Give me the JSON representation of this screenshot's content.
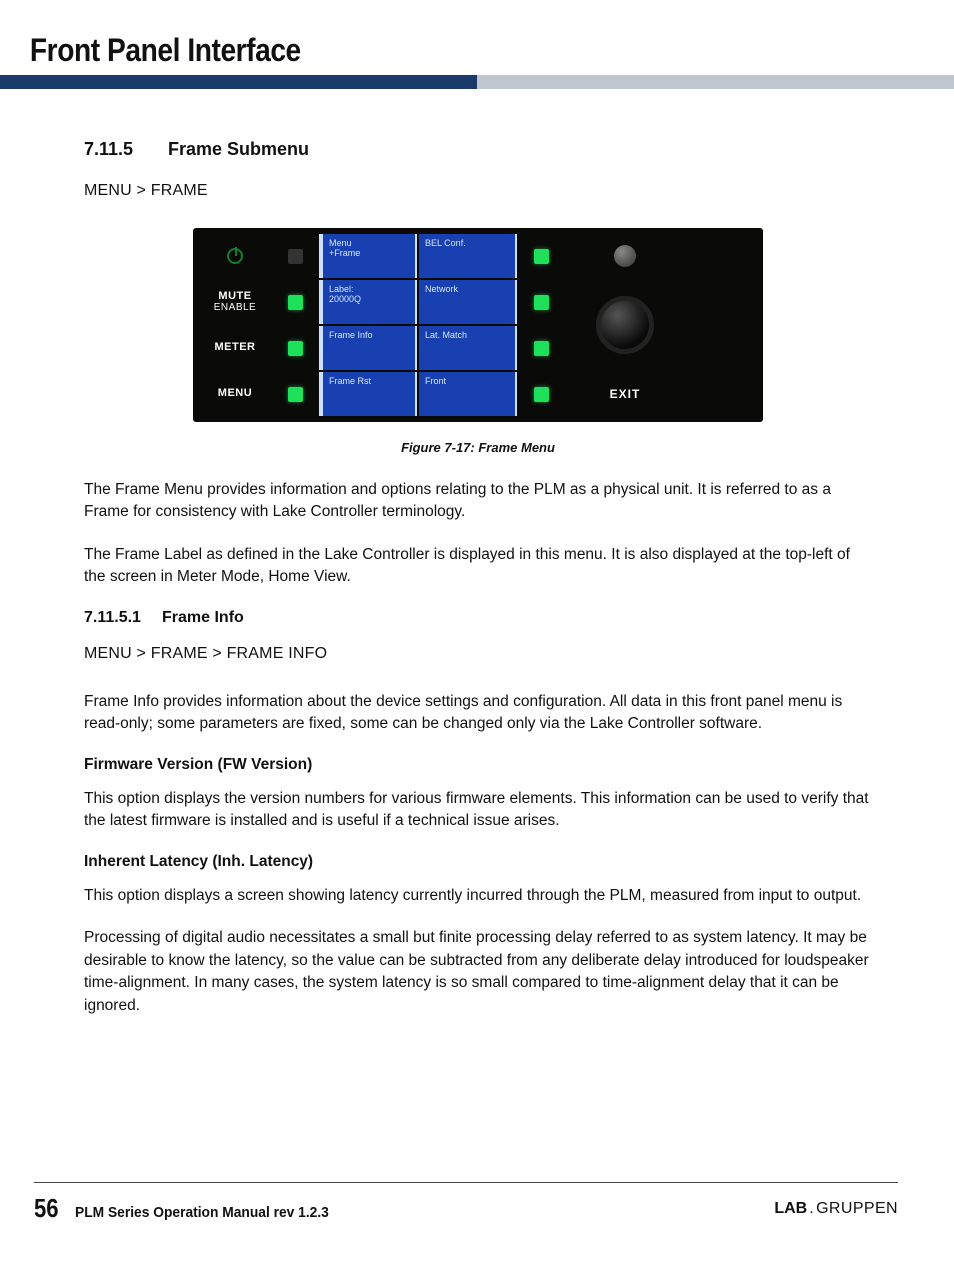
{
  "header": {
    "page_title": "Front Panel Interface"
  },
  "section_7_11_5": {
    "num": "7.11.5",
    "title": "Frame Submenu",
    "breadcrumb": "MENU > FRAME"
  },
  "panel": {
    "row_labels": [
      {
        "main": "",
        "sub": "",
        "icon": "power"
      },
      {
        "main": "MUTE",
        "sub": "ENABLE"
      },
      {
        "main": "METER",
        "sub": ""
      },
      {
        "main": "MENU",
        "sub": ""
      }
    ],
    "screen_col1": [
      {
        "l1": "Menu",
        "l2": "+Frame"
      },
      {
        "l1": "Label:",
        "l2": "20000Q"
      },
      {
        "l1": "Frame Info",
        "l2": ""
      },
      {
        "l1": "Frame Rst",
        "l2": ""
      }
    ],
    "screen_col2": [
      {
        "l1": "BEL Conf.",
        "l2": ""
      },
      {
        "l1": "Network",
        "l2": ""
      },
      {
        "l1": "Lat. Match",
        "l2": ""
      },
      {
        "l1": "Front",
        "l2": ""
      }
    ],
    "exit_label": "EXIT"
  },
  "figure_caption": "Figure 7-17: Frame Menu",
  "para1": "The Frame Menu provides information and options relating to the PLM as a physical unit. It is referred to as a Frame for consistency with Lake Controller terminology.",
  "para2": "The Frame Label as defined in the Lake Controller is displayed in this menu. It is also displayed at the top-left of the screen in Meter Mode, Home View.",
  "section_7_11_5_1": {
    "num": "7.11.5.1",
    "title": "Frame Info",
    "breadcrumb": "MENU > FRAME > FRAME INFO"
  },
  "para3": "Frame Info provides information about the device settings and configuration. All data in this front panel menu is read-only; some parameters are fixed, some can be changed only via the Lake Controller software.",
  "fw_heading": "Firmware Version (FW Version)",
  "para4": "This option displays the version numbers for various firmware elements. This information can be used to verify that the latest firmware is installed and is useful if a technical issue arises.",
  "inh_heading": "Inherent Latency (Inh. Latency)",
  "para5": "This option displays a screen showing latency currently incurred through the PLM, measured from input to output.",
  "para6": "Processing of digital audio necessitates a small but finite processing delay referred to as system latency. It may be desirable to know the latency, so the value can be subtracted from any deliberate delay introduced for loudspeaker time-alignment. In many cases, the system latency is so small compared to time-alignment delay that it can be ignored.",
  "footer": {
    "page_number": "56",
    "text": "PLM Series Operation Manual rev 1.2.3",
    "brand_lab": "LAB",
    "brand_dot": ".",
    "brand_rest": "GRUPPEN"
  }
}
